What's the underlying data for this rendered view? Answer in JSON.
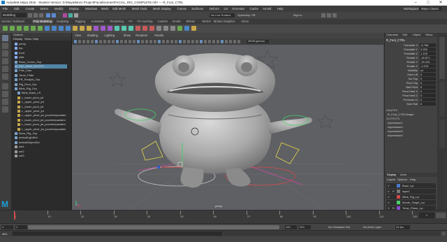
{
  "titlebar": {
    "title": "Autodesk Maya 2016 - Student Version: D:\\Maya\\Mozo Project\\Facial\\scenes\\FACIAL_RIG_COMPLETE.mb* --- R_Foot_CTRL",
    "min": "–",
    "max": "□",
    "close": "✕"
  },
  "menubar": {
    "items": [
      "File",
      "Edit",
      "Create",
      "Select",
      "Modify",
      "Display",
      "Windows",
      "Mesh",
      "Edit Mesh",
      "Mesh Tools",
      "Mesh Display",
      "Curves",
      "Surfaces",
      "Deform",
      "UV",
      "Generate",
      "Cache",
      "Arnold",
      "Help"
    ],
    "workspace_label": "Workspace:",
    "workspace_value": "Maya Classic"
  },
  "statusline": {
    "mode": "Modelling",
    "symmetry": "Symmetry: Off",
    "no_live": "No Live Surface",
    "signin": "Sign In"
  },
  "shelf": {
    "tabs": [
      "Curves / Surfaces",
      "Poly Modeling",
      "Sculpting",
      "Rigging",
      "Animation",
      "Rendering",
      "FX",
      "FX Caching",
      "Custom",
      "Arnold",
      "Bifrost",
      "MASH",
      "Motion Graphics",
      "XGen"
    ],
    "active_tab": "Poly Modeling"
  },
  "outliner": {
    "title": "Outliner",
    "menu": [
      "Display",
      "Show",
      "Help"
    ],
    "items": [
      "persp",
      "top",
      "front",
      "side",
      "Ross_Correc_Grp",
      "RIG_MAIN_ROOTS",
      "Fritz_Cam",
      "Tenor_Plate",
      "PR_Rootpls_Grp",
      "Rig_Root_Grp",
      "Blink_Rig_Grp",
      "Blink_Base_LR",
      "L_lower_pivot_jnt",
      "L_upper_pivot_jnt",
      "L_lower_pivot_jnt",
      "L_upper_pivot_jnt",
      "L_upper_pivot_jnt_pccelerepaulator",
      "L_lower_pivot_jnt_pccelerepaulator",
      "L_lower_pivot_jnt_pccelerepaulator",
      "L_upper_pivot_jnt_pccelerepaulator",
      "Brow_Rig_Grp",
      "defaultLightSet",
      "defaultObjectSet",
      "set1",
      "set2",
      "set3"
    ]
  },
  "viewport": {
    "menu": [
      "View",
      "Shading",
      "Lighting",
      "Show",
      "Renderer",
      "Panels"
    ],
    "camera_label": "persp",
    "gamma": "sRGB gamma"
  },
  "channelbox": {
    "tabs": [
      "Channels",
      "Edit",
      "Object",
      "Show"
    ],
    "object": "R_Foot_CTRL",
    "attrs": [
      {
        "name": "Translate X",
        "value": "-6.768"
      },
      {
        "name": "Translate Y",
        "value": "0.259"
      },
      {
        "name": "Translate Z",
        "value": "1.129"
      },
      {
        "name": "Rotate X",
        "value": "-16.871"
      },
      {
        "name": "Rotate Y",
        "value": "-29.191"
      },
      {
        "name": "Rotate Z",
        "value": "-1.076"
      },
      {
        "name": "Visibility",
        "value": "on"
      },
      {
        "name": "Heel Lift",
        "value": "0"
      },
      {
        "name": "Toe Tap",
        "value": "0"
      },
      {
        "name": "Pivot Tap",
        "value": "0"
      },
      {
        "name": "Ball Pivot",
        "value": "0"
      },
      {
        "name": "Pivot Heel X",
        "value": "0"
      },
      {
        "name": "Pivot Heel Z",
        "value": "0"
      },
      {
        "name": "Pressure Lt",
        "value": "0"
      },
      {
        "name": "Side Roll",
        "value": "0"
      }
    ],
    "shapes_label": "SHAPES",
    "shape_name": "R_Foot_CTRLShape",
    "outputs_label": "OUTPUTS",
    "outputs": [
      "expression1",
      "expression2",
      "expression3",
      "expression4"
    ]
  },
  "layers": {
    "tabs": [
      "Display",
      "Anim"
    ],
    "menu": [
      "Layers",
      "Options",
      "Help"
    ],
    "rows": [
      {
        "v": "V",
        "p": "",
        "name": "Base_Lyr",
        "color": "#4a7bd0"
      },
      {
        "v": "V",
        "p": "P",
        "name": "layer1",
        "color": "#777777"
      },
      {
        "v": "V",
        "p": "",
        "name": "Blink_Rig_Lyr",
        "color": "#d04a4a"
      },
      {
        "v": "V",
        "p": "",
        "name": "Mouth_Target_Lyr",
        "color": "#4ad06a"
      },
      {
        "v": "V",
        "p": "R",
        "name": "Temp_Plane_Lyr",
        "color": "#8a4ad0"
      },
      {
        "v": "V",
        "p": "",
        "name": "Eyes_lyr",
        "color": "#d0c04a"
      }
    ]
  },
  "timeslider": {
    "ticks": [
      "1",
      "10",
      "20",
      "30",
      "40",
      "50",
      "60",
      "70",
      "80",
      "90",
      "100",
      "110",
      "120"
    ],
    "current_frame": "1"
  },
  "rangebar": {
    "start": "1",
    "inner_start": "1",
    "inner_end": "120",
    "end": "200",
    "char_set": "No Character Set",
    "anim_layer": "No Anim Layer",
    "fps": "24 fps"
  },
  "cmdline": {
    "lang": "MEL"
  },
  "colors": {
    "accent": "#4a90d9",
    "viewport": "#5e6064",
    "selected_row": "#5285a6"
  }
}
